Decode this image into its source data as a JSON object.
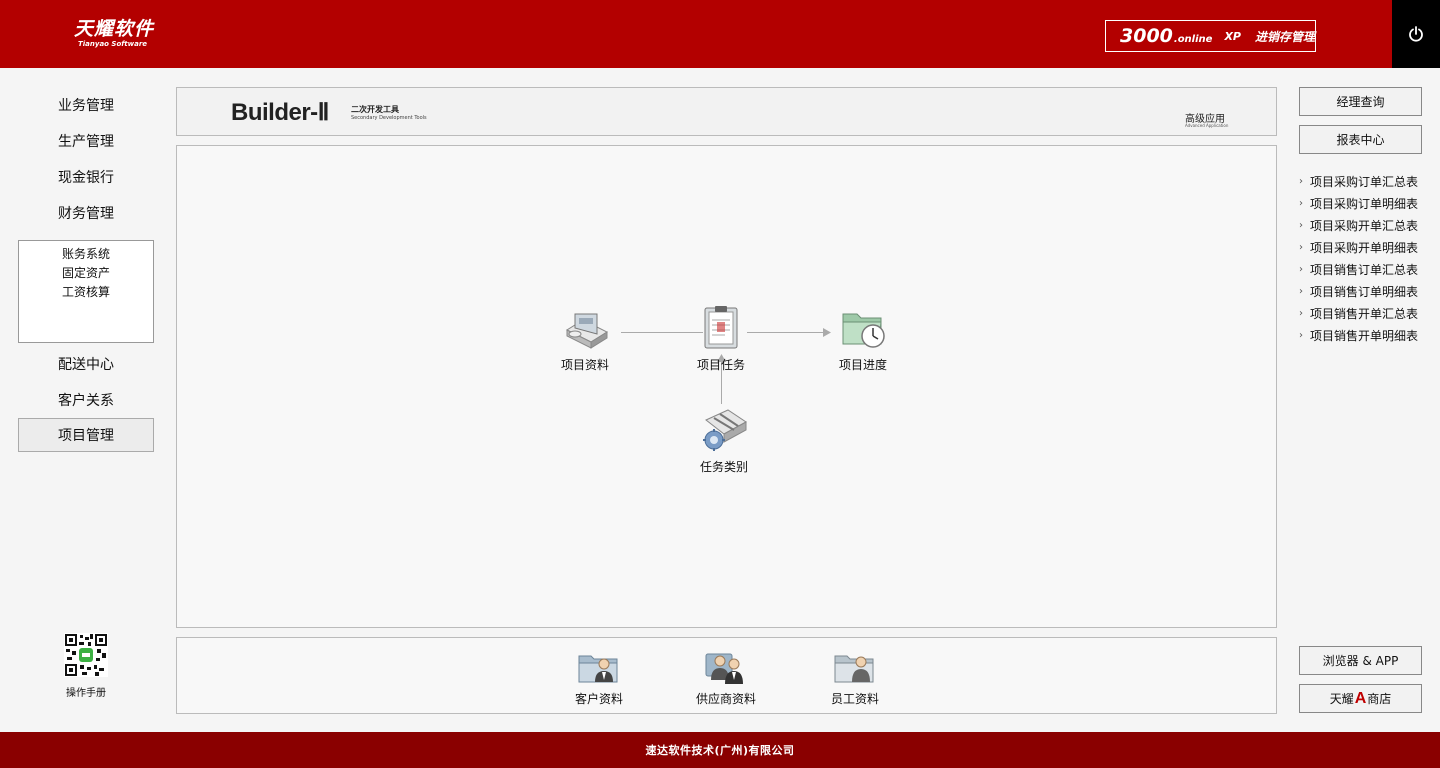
{
  "header": {
    "logo_cn": "天耀软件",
    "logo_en": "Tianyao Software",
    "badge_number": "3000",
    "badge_online": ".online",
    "badge_xp": "XP",
    "badge_name": "进销存管理",
    "power_icon": "power-icon"
  },
  "sidebar": {
    "items": [
      {
        "label": "业务管理"
      },
      {
        "label": "生产管理"
      },
      {
        "label": "现金银行"
      },
      {
        "label": "财务管理"
      }
    ],
    "sub_items": [
      {
        "label": "账务系统"
      },
      {
        "label": "固定资产"
      },
      {
        "label": "工资核算"
      }
    ],
    "items_after": [
      {
        "label": "配送中心"
      },
      {
        "label": "客户关系"
      },
      {
        "label": "项目管理"
      }
    ],
    "manual_label": "操作手册"
  },
  "banner": {
    "title": "Builder-Ⅱ",
    "subtitle_cn": "二次开发工具",
    "subtitle_en": "Secondary Development Tools",
    "advanced_cn": "高级应用",
    "advanced_en": "Advanced Application"
  },
  "workspace": {
    "nodes": {
      "project_info": "项目资料",
      "project_task": "项目任务",
      "project_progress": "项目进度",
      "task_category": "任务类别"
    }
  },
  "bottom": {
    "customer": "客户资料",
    "supplier": "供应商资料",
    "employee": "员工资料"
  },
  "right": {
    "manager_query": "经理查询",
    "report_center": "报表中心",
    "reports": [
      "项目采购订单汇总表",
      "项目采购订单明细表",
      "项目采购开单汇总表",
      "项目采购开单明细表",
      "项目销售订单汇总表",
      "项目销售订单明细表",
      "项目销售开单汇总表",
      "项目销售开单明细表"
    ],
    "browser_app": "浏览器 & APP",
    "store_prefix": "天耀",
    "store_a": "A",
    "store_suffix": "商店"
  },
  "footer": {
    "company": "速达软件技术(广州)有限公司"
  },
  "colors": {
    "header_red": "#b30000",
    "footer_red": "#8a0000",
    "store_accent": "#c00000"
  }
}
